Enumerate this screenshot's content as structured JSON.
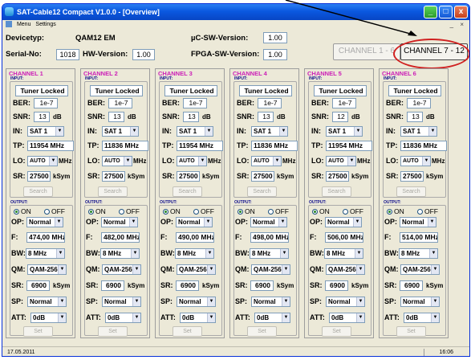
{
  "window": {
    "title": "SAT-Cable12 Compact V1.0.0 - [Overview]",
    "menu": [
      "Menu",
      "Settings"
    ],
    "controls": [
      "_",
      "□",
      "x"
    ],
    "mdi_controls": "_ ×"
  },
  "device": {
    "type_label": "Devicetyp:",
    "type_value": "QAM12 EM",
    "serial_label": "Serial-No:",
    "serial_value": "1018",
    "hw_label": "HW-Version:",
    "hw_value": "1.00",
    "uc_label": "µC-SW-Version:",
    "uc_value": "1.00",
    "fpga_label": "FPGA-SW-Version:",
    "fpga_value": "1.00"
  },
  "channel_buttons": {
    "left": "CHANNEL 1 - 6",
    "right": "CHANNEL 7 - 12"
  },
  "labels": {
    "input": "INPUT:",
    "output": "OUTPUT:",
    "ber": "BER:",
    "snr": "SNR:",
    "in": "IN:",
    "tp": "TP:",
    "lo": "LO:",
    "sr": "SR:",
    "search": "Search",
    "on": "ON",
    "off": "OFF",
    "op": "OP:",
    "f": "F:",
    "bw": "BW:",
    "qm": "QM:",
    "sp": "SP:",
    "att": "ATT:",
    "set": "Set",
    "mhz": "MHz",
    "ksym": "kSym",
    "db": "dB"
  },
  "channels": [
    {
      "title": "CHANNEL 1",
      "status": "Tuner Locked",
      "ber": "1e-7",
      "snr": "13",
      "in": "SAT 1",
      "tp": "11954 MHz",
      "lo": "AUTO",
      "sr": "27500",
      "out_on": true,
      "op": "Normal",
      "f": "474,00 MHz",
      "bw": "8 MHz",
      "qm": "QAM-256",
      "osr": "6900",
      "sp": "Normal",
      "att": "0dB"
    },
    {
      "title": "CHANNEL 2",
      "status": "Tuner Locked",
      "ber": "1e-7",
      "snr": "13",
      "in": "SAT 1",
      "tp": "11836 MHz",
      "lo": "AUTO",
      "sr": "27500",
      "out_on": true,
      "op": "Normal",
      "f": "482,00 MHz",
      "bw": "8 MHz",
      "qm": "QAM-256",
      "osr": "6900",
      "sp": "Normal",
      "att": "0dB"
    },
    {
      "title": "CHANNEL 3",
      "status": "Tuner Locked",
      "ber": "1e-7",
      "snr": "13",
      "in": "SAT 1",
      "tp": "11954 MHz",
      "lo": "AUTO",
      "sr": "27500",
      "out_on": true,
      "op": "Normal",
      "f": "490,00 MHz",
      "bw": "8 MHz",
      "qm": "QAM-256",
      "osr": "6900",
      "sp": "Normal",
      "att": "0dB"
    },
    {
      "title": "CHANNEL 4",
      "status": "Tuner Locked",
      "ber": "1e-7",
      "snr": "13",
      "in": "SAT 1",
      "tp": "11836 MHz",
      "lo": "AUTO",
      "sr": "27500",
      "out_on": true,
      "op": "Normal",
      "f": "498,00 MHz",
      "bw": "8 MHz",
      "qm": "QAM-256",
      "osr": "6900",
      "sp": "Normal",
      "att": "0dB"
    },
    {
      "title": "CHANNEL 5",
      "status": "Tuner Locked",
      "ber": "1e-7",
      "snr": "12",
      "in": "SAT 1",
      "tp": "11954 MHz",
      "lo": "AUTO",
      "sr": "27500",
      "out_on": true,
      "op": "Normal",
      "f": "506,00 MHz",
      "bw": "8 MHz",
      "qm": "QAM-256",
      "osr": "6900",
      "sp": "Normal",
      "att": "0dB"
    },
    {
      "title": "CHANNEL 6",
      "status": "Tuner Locked",
      "ber": "1e-7",
      "snr": "13",
      "in": "SAT 1",
      "tp": "11836 MHz",
      "lo": "AUTO",
      "sr": "27500",
      "out_on": true,
      "op": "Normal",
      "f": "514,00 MHz",
      "bw": "8 MHz",
      "qm": "QAM-256",
      "osr": "6900",
      "sp": "Normal",
      "att": "0dB"
    }
  ],
  "status": {
    "date": "17.05.2011",
    "time": "16:06"
  },
  "colors": {
    "channel_title": "#cc1fb7",
    "highlight_ellipse": "#d02020",
    "titlebar": "#0a58e0"
  }
}
